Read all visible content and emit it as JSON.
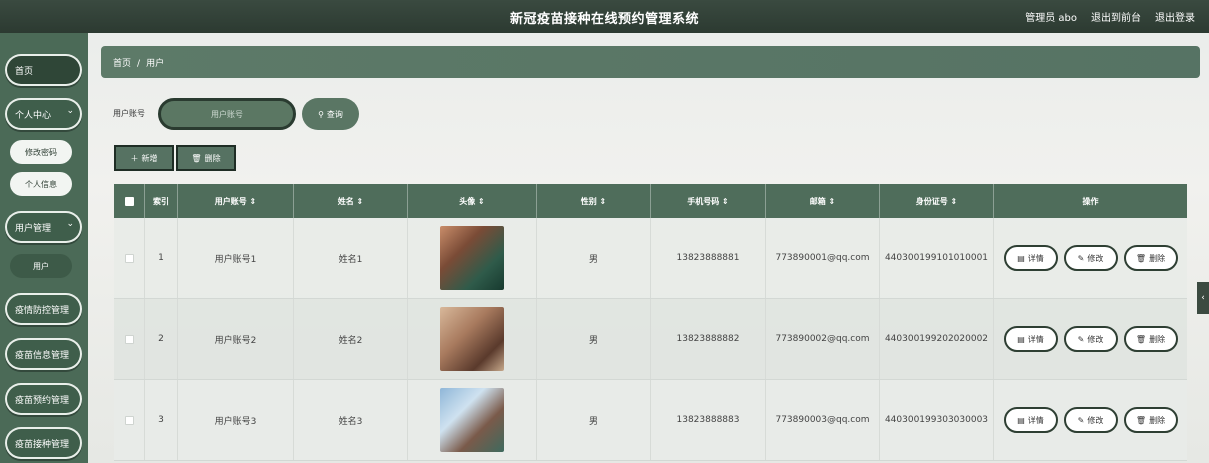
{
  "header": {
    "title": "新冠疫苗接种在线预约管理系统",
    "user": "管理员 abo",
    "to_frontend": "退出到前台",
    "logout": "退出登录"
  },
  "sidebar": {
    "home": "首页",
    "personal_center": "个人中心",
    "change_password": "修改密码",
    "personal_info": "个人信息",
    "user_management": "用户管理",
    "users": "用户",
    "epidemic_control": "疫情防控管理",
    "vaccine_info": "疫苗信息管理",
    "vaccine_booking": "疫苗预约管理",
    "vaccine_injection": "疫苗接种管理"
  },
  "breadcrumb": {
    "home": "首页",
    "sep": "/",
    "current": "用户"
  },
  "search": {
    "label": "用户账号",
    "placeholder": "用户账号",
    "button": "查询"
  },
  "toolbar": {
    "add": "新增",
    "delete": "删除"
  },
  "table": {
    "headers": [
      "索引",
      "用户账号 ⇕",
      "姓名 ⇕",
      "头像 ⇕",
      "性别 ⇕",
      "手机号码 ⇕",
      "邮箱 ⇕",
      "身份证号 ⇕",
      "操作"
    ],
    "rows": [
      {
        "index": "1",
        "account": "用户账号1",
        "name": "姓名1",
        "gender": "男",
        "phone": "13823888881",
        "email": "773890001@qq.com",
        "id": "440300199101010001"
      },
      {
        "index": "2",
        "account": "用户账号2",
        "name": "姓名2",
        "gender": "男",
        "phone": "13823888882",
        "email": "773890002@qq.com",
        "id": "440300199202020002"
      },
      {
        "index": "3",
        "account": "用户账号3",
        "name": "姓名3",
        "gender": "男",
        "phone": "13823888883",
        "email": "773890003@qq.com",
        "id": "440300199303030003"
      }
    ],
    "actions": {
      "detail": "详情",
      "edit": "修改",
      "delete": "删除"
    }
  },
  "colors": {
    "primary": "#4f6d5b",
    "header": "#2c3a31",
    "sidebar": "#4b6a57"
  }
}
